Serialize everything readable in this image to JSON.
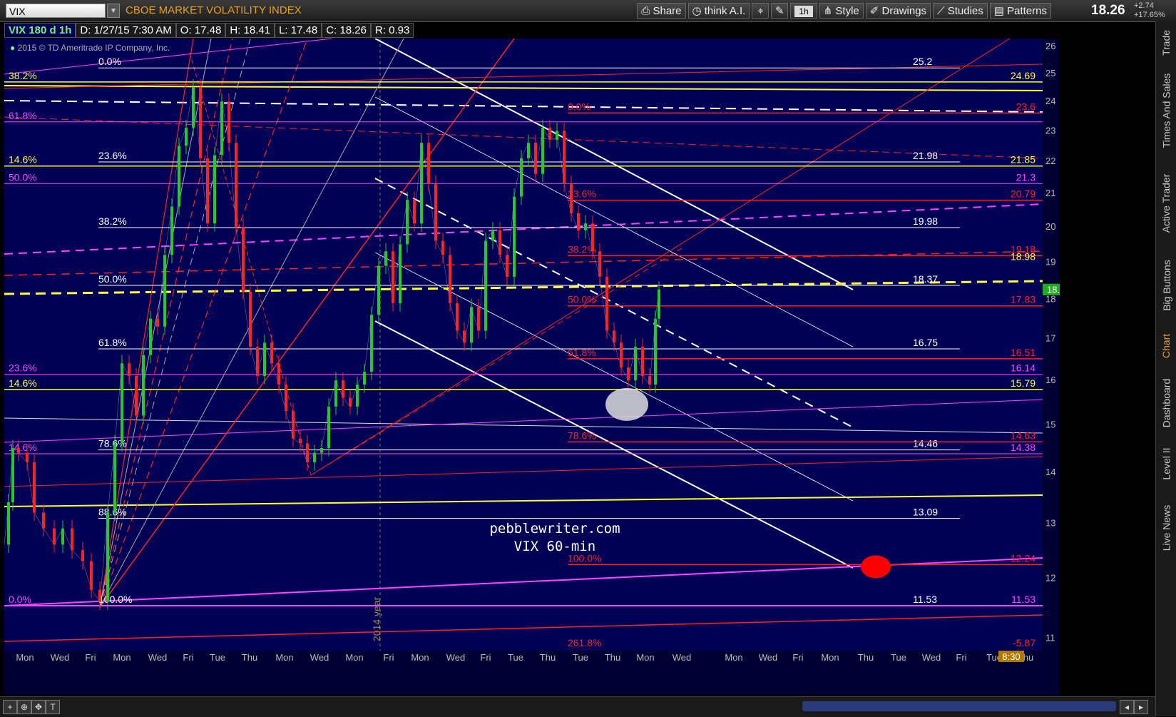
{
  "toolbar": {
    "symbol": "VIX",
    "symbol_name": "CBOE MARKET VOLATILITY INDEX",
    "share_label": "Share",
    "think_ai_label": "think A.I.",
    "timeframe_label": "1h",
    "style_label": "Style",
    "drawings_label": "Drawings",
    "studies_label": "Studies",
    "patterns_label": "Patterns",
    "last_price": "18.26",
    "change_abs": "+2.74",
    "change_pct": "+17.65%"
  },
  "info": {
    "symbol_period": "VIX 180 d 1h",
    "date": "D: 1/27/15 7:30 AM",
    "open": "O: 17.48",
    "high": "H: 18.41",
    "low": "L: 17.48",
    "close": "C: 18.26",
    "range": "R: 0.93",
    "copyright": "2015 © TD Ameritrade IP Company, Inc."
  },
  "sidebar": {
    "tabs": [
      "Trade",
      "Times And Sales",
      "Active Trader",
      "Big Buttons",
      "Chart",
      "Dashboard",
      "Level II",
      "Live News"
    ],
    "active": "Chart"
  },
  "bottom": {
    "time_box": "8:30"
  },
  "colors": {
    "background": "#000055",
    "fib_white": "#ffffff",
    "fib_red": "#ff2222",
    "fib_magenta": "#ff44ff",
    "fib_yellow": "#ffff33",
    "candle_up": "#22cc22",
    "candle_down": "#ff2222"
  },
  "chart_data": {
    "type": "candlestick",
    "title": "pebblewriter.com VIX 60-min",
    "watermark": [
      "pebblewriter.com",
      "VIX 60-min"
    ],
    "xlabel": "",
    "ylabel": "",
    "ylim": [
      10.8,
      26.3
    ],
    "yscale": "log",
    "y_ticks": [
      26,
      25,
      24,
      23,
      22,
      21,
      20,
      19,
      18,
      17,
      16,
      15,
      14,
      13,
      12,
      11
    ],
    "x_ticks": [
      "Mon",
      "Wed",
      "Fri",
      "Mon",
      "Wed",
      "Fri",
      "Tue",
      "Thu",
      "Mon",
      "Wed",
      "Mon",
      "Fri",
      "Mon",
      "Wed",
      "Fri",
      "Tue",
      "Thu",
      "Tue",
      "Thu",
      "Mon",
      "Wed",
      "Mon",
      "Wed",
      "Fri",
      "Mon",
      "Thu",
      "Tue",
      "Wed",
      "Fri",
      "Tue",
      "Thu"
    ],
    "year_marker": "2014 year",
    "current_price_label": "18.26",
    "price_path": [
      {
        "x": 0,
        "y": 12.6
      },
      {
        "x": 6,
        "y": 13.4
      },
      {
        "x": 12,
        "y": 14.5
      },
      {
        "x": 20,
        "y": 14.4
      },
      {
        "x": 32,
        "y": 14.2
      },
      {
        "x": 42,
        "y": 13.2
      },
      {
        "x": 55,
        "y": 12.9
      },
      {
        "x": 70,
        "y": 12.6
      },
      {
        "x": 82,
        "y": 12.9
      },
      {
        "x": 95,
        "y": 12.5
      },
      {
        "x": 110,
        "y": 12.3
      },
      {
        "x": 122,
        "y": 11.8
      },
      {
        "x": 134,
        "y": 11.6
      },
      {
        "x": 145,
        "y": 13.2
      },
      {
        "x": 155,
        "y": 14.6
      },
      {
        "x": 165,
        "y": 16.4
      },
      {
        "x": 175,
        "y": 16.1
      },
      {
        "x": 185,
        "y": 15.2
      },
      {
        "x": 195,
        "y": 16.6
      },
      {
        "x": 205,
        "y": 17.5
      },
      {
        "x": 215,
        "y": 17.3
      },
      {
        "x": 225,
        "y": 19.2
      },
      {
        "x": 235,
        "y": 20.6
      },
      {
        "x": 245,
        "y": 22.5
      },
      {
        "x": 255,
        "y": 23.1
      },
      {
        "x": 265,
        "y": 24.5
      },
      {
        "x": 275,
        "y": 22.1
      },
      {
        "x": 285,
        "y": 20.1
      },
      {
        "x": 295,
        "y": 22.2
      },
      {
        "x": 305,
        "y": 24.0
      },
      {
        "x": 315,
        "y": 22.6
      },
      {
        "x": 325,
        "y": 20.0
      },
      {
        "x": 335,
        "y": 18.2
      },
      {
        "x": 345,
        "y": 16.8
      },
      {
        "x": 355,
        "y": 16.1
      },
      {
        "x": 365,
        "y": 16.9
      },
      {
        "x": 375,
        "y": 16.4
      },
      {
        "x": 385,
        "y": 15.9
      },
      {
        "x": 395,
        "y": 15.3
      },
      {
        "x": 405,
        "y": 14.7
      },
      {
        "x": 415,
        "y": 14.6
      },
      {
        "x": 425,
        "y": 14.2
      },
      {
        "x": 435,
        "y": 14.4
      },
      {
        "x": 445,
        "y": 14.5
      },
      {
        "x": 455,
        "y": 15.4
      },
      {
        "x": 465,
        "y": 16.0
      },
      {
        "x": 475,
        "y": 15.6
      },
      {
        "x": 485,
        "y": 15.4
      },
      {
        "x": 495,
        "y": 15.9
      },
      {
        "x": 505,
        "y": 16.2
      },
      {
        "x": 515,
        "y": 17.6
      },
      {
        "x": 525,
        "y": 18.9
      },
      {
        "x": 535,
        "y": 19.3
      },
      {
        "x": 545,
        "y": 17.9
      },
      {
        "x": 555,
        "y": 19.5
      },
      {
        "x": 565,
        "y": 20.8
      },
      {
        "x": 575,
        "y": 20.1
      },
      {
        "x": 585,
        "y": 22.6
      },
      {
        "x": 595,
        "y": 21.3
      },
      {
        "x": 605,
        "y": 19.6
      },
      {
        "x": 615,
        "y": 19.2
      },
      {
        "x": 625,
        "y": 17.9
      },
      {
        "x": 635,
        "y": 17.2
      },
      {
        "x": 645,
        "y": 16.9
      },
      {
        "x": 655,
        "y": 17.8
      },
      {
        "x": 665,
        "y": 17.2
      },
      {
        "x": 675,
        "y": 19.6
      },
      {
        "x": 685,
        "y": 19.9
      },
      {
        "x": 695,
        "y": 19.2
      },
      {
        "x": 705,
        "y": 18.6
      },
      {
        "x": 715,
        "y": 20.9
      },
      {
        "x": 725,
        "y": 22.1
      },
      {
        "x": 735,
        "y": 22.6
      },
      {
        "x": 745,
        "y": 21.6
      },
      {
        "x": 755,
        "y": 23.1
      },
      {
        "x": 765,
        "y": 22.7
      },
      {
        "x": 775,
        "y": 23.0
      },
      {
        "x": 785,
        "y": 21.3
      },
      {
        "x": 795,
        "y": 20.4
      },
      {
        "x": 805,
        "y": 19.9
      },
      {
        "x": 815,
        "y": 20.1
      },
      {
        "x": 825,
        "y": 19.3
      },
      {
        "x": 835,
        "y": 18.6
      },
      {
        "x": 845,
        "y": 17.2
      },
      {
        "x": 855,
        "y": 16.9
      },
      {
        "x": 865,
        "y": 16.3
      },
      {
        "x": 875,
        "y": 16.0
      },
      {
        "x": 885,
        "y": 16.8
      },
      {
        "x": 895,
        "y": 16.1
      },
      {
        "x": 905,
        "y": 15.9
      },
      {
        "x": 913,
        "y": 17.5
      },
      {
        "x": 918,
        "y": 18.26
      }
    ],
    "fib_white": {
      "levels": [
        "0.0%",
        "23.6%",
        "38.2%",
        "50.0%",
        "61.8%",
        "78.6%",
        "88.6%",
        "100.0%"
      ],
      "prices": [
        25.2,
        21.98,
        19.98,
        18.37,
        16.75,
        14.46,
        13.09,
        11.53
      ]
    },
    "fib_red": {
      "levels": [
        "0.0%",
        "23.6%",
        "38.2%",
        "50.0%",
        "61.8%",
        "78.6%",
        "100.0%",
        "261.8%"
      ],
      "prices": [
        23.6,
        20.79,
        19.18,
        17.83,
        16.51,
        14.63,
        12.24,
        -5.87
      ],
      "price_labels": [
        "23.6",
        "20.79",
        "19.18",
        "17.83",
        "16.51",
        "14.63",
        "12.24",
        "-5.87"
      ]
    },
    "fib_magenta": {
      "levels": [
        "61.8%",
        "50.0%",
        "23.6%",
        "14.6%",
        "0.0%"
      ],
      "prices": [
        23.3,
        21.3,
        16.14,
        14.38,
        11.53
      ],
      "price_labels": [
        "21.3",
        "16.14",
        "14.38",
        "11.53"
      ]
    },
    "fib_yellow": {
      "levels": [
        "38.2%",
        "14.6%",
        "14.6%"
      ],
      "prices": [
        24.69,
        21.85,
        15.79
      ],
      "price_labels": [
        "24.69",
        "21.85",
        "15.79",
        "18.98"
      ]
    },
    "left_labels": {
      "white": [
        "14.6%",
        "23.6%",
        "38.2%",
        "0.0%",
        "88.6%",
        "78.6%",
        "61.8%",
        "50.0%"
      ],
      "yellow": [
        "38.2%",
        "14.6%"
      ],
      "magenta": [
        "61.8%",
        "50.0%",
        "23.6%",
        "14.6%",
        "0.0%",
        "23.6%"
      ]
    },
    "annotations": [
      {
        "type": "ellipse",
        "x": 873,
        "y": 15.45,
        "color": "#dddddd"
      },
      {
        "type": "dot",
        "x": 1222,
        "y": 12.2,
        "color": "#ff0000"
      }
    ]
  }
}
